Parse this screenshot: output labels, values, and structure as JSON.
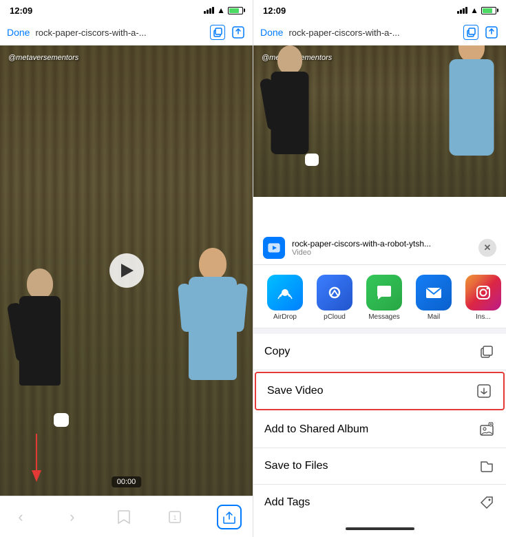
{
  "left_phone": {
    "status_bar": {
      "time": "12:09",
      "battery_label": "battery"
    },
    "address_bar": {
      "done_label": "Done",
      "url": "rock-paper-ciscors-with-a-...",
      "copy_icon_label": "copy-tab-icon",
      "share_icon_label": "share-icon"
    },
    "video": {
      "watermark": "@metaversementors",
      "timestamp": "00:00",
      "play_button": "play"
    },
    "bottom_bar": {
      "back_label": "back",
      "forward_label": "forward",
      "bookmark_label": "bookmark",
      "tabs_label": "tabs",
      "share_label": "share"
    }
  },
  "right_phone": {
    "status_bar": {
      "time": "12:09"
    },
    "address_bar": {
      "done_label": "Done",
      "url": "rock-paper-ciscors-with-a-...",
      "copy_icon_label": "copy-tab-icon",
      "share_icon_label": "share-icon"
    },
    "video": {
      "watermark": "@metaversementors"
    },
    "share_sheet": {
      "icon_label": "video-icon",
      "title": "rock-paper-ciscors-with-a-robot-ytsh...",
      "subtitle": "Video",
      "close_label": "✕",
      "apps": [
        {
          "name": "airdrop",
          "label": "AirDrop",
          "icon": "📡"
        },
        {
          "name": "pcloud",
          "label": "pCloud",
          "icon": "☁"
        },
        {
          "name": "messages",
          "label": "Messages",
          "icon": "💬"
        },
        {
          "name": "mail",
          "label": "Mail",
          "icon": "✉"
        },
        {
          "name": "instagram",
          "label": "Ins...",
          "icon": "📷"
        }
      ],
      "actions": [
        {
          "name": "copy",
          "label": "Copy",
          "icon": "copy"
        },
        {
          "name": "save-video",
          "label": "Save Video",
          "icon": "save",
          "highlighted": true
        },
        {
          "name": "add-shared-album",
          "label": "Add to Shared Album",
          "icon": "album"
        },
        {
          "name": "save-to-files",
          "label": "Save to Files",
          "icon": "files"
        },
        {
          "name": "add-tags",
          "label": "Add Tags",
          "icon": "tags"
        }
      ]
    }
  }
}
